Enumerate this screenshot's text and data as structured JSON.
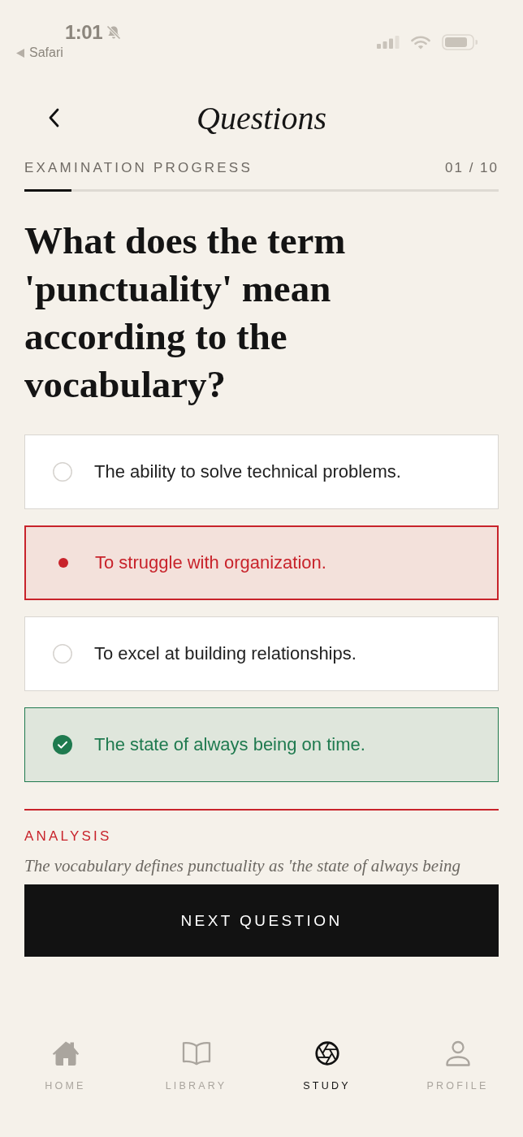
{
  "status_bar": {
    "time": "1:01",
    "back_app": "Safari"
  },
  "header": {
    "title": "Questions"
  },
  "progress": {
    "label": "EXAMINATION PROGRESS",
    "count": "01 / 10",
    "level": 0.1
  },
  "question": "What does the term 'punctuality' mean according to the vocabulary?",
  "options": [
    {
      "text": "The ability to solve technical problems.",
      "selected": false,
      "correct": false
    },
    {
      "text": "To struggle with organization.",
      "selected": true,
      "correct": false
    },
    {
      "text": "To excel at building relationships.",
      "selected": false,
      "correct": false
    },
    {
      "text": "The state of always being on time.",
      "selected": false,
      "correct": true
    }
  ],
  "analysis": {
    "label": "ANALYSIS",
    "text": "The vocabulary defines punctuality as 'the state of always being"
  },
  "next_button": "NEXT QUESTION",
  "tabs": [
    {
      "label": "HOME",
      "selected": false
    },
    {
      "label": "LIBRARY",
      "selected": false
    },
    {
      "label": "STUDY",
      "selected": true
    },
    {
      "label": "PROFILE",
      "selected": false
    }
  ]
}
